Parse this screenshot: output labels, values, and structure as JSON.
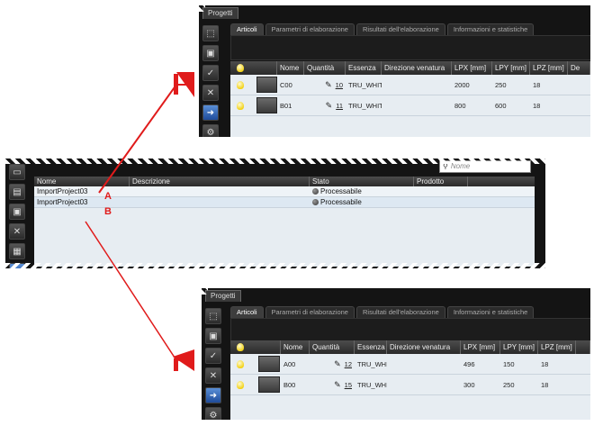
{
  "top_panel": {
    "window_tab": "Progetti",
    "tabs": [
      "Articoli",
      "Parametri di elaborazione",
      "Risultati dell'elaborazione",
      "Informazioni e statistiche"
    ],
    "active_tab": "Articoli",
    "columns": [
      "Nome",
      "Quantità",
      "Essenza",
      "Direzione venatura",
      "LPX [mm]",
      "LPY [mm]",
      "LPZ [mm]",
      "De"
    ],
    "rows": [
      {
        "name": "C00",
        "qty": "10",
        "essence": "TRU_WHITE",
        "grain": "",
        "lpx": "2000",
        "lpy": "250",
        "lpz": "18"
      },
      {
        "name": "B01",
        "qty": "11",
        "essence": "TRU_WHITE",
        "grain": "",
        "lpx": "800",
        "lpy": "600",
        "lpz": "18"
      }
    ]
  },
  "middle_panel": {
    "search_placeholder": "Nome",
    "columns": [
      "Nome",
      "Descrizione",
      "Stato",
      "Prodotto"
    ],
    "rows": [
      {
        "name": "ImportProject03",
        "description": "",
        "status": "Processabile",
        "product": ""
      },
      {
        "name": "ImportProject03",
        "description": "",
        "status": "Processabile",
        "product": ""
      }
    ]
  },
  "bottom_panel": {
    "window_tab": "Progetti",
    "tabs": [
      "Articoli",
      "Parametri di elaborazione",
      "Risultati dell'elaborazione",
      "Informazioni e statistiche"
    ],
    "active_tab": "Articoli",
    "columns": [
      "Nome",
      "Quantità",
      "Essenza",
      "Direzione venatura",
      "LPX [mm]",
      "LPY [mm]",
      "LPZ [mm]",
      ""
    ],
    "rows": [
      {
        "name": "A00",
        "qty": "12",
        "essence": "TRU_WHITE",
        "grain": "",
        "lpx": "496",
        "lpy": "150",
        "lpz": "18"
      },
      {
        "name": "B00",
        "qty": "15",
        "essence": "TRU_WHITE",
        "grain": "",
        "lpx": "300",
        "lpy": "250",
        "lpz": "18"
      }
    ]
  },
  "callouts": {
    "a": "A",
    "b": "B",
    "color": "#e01b1b"
  }
}
